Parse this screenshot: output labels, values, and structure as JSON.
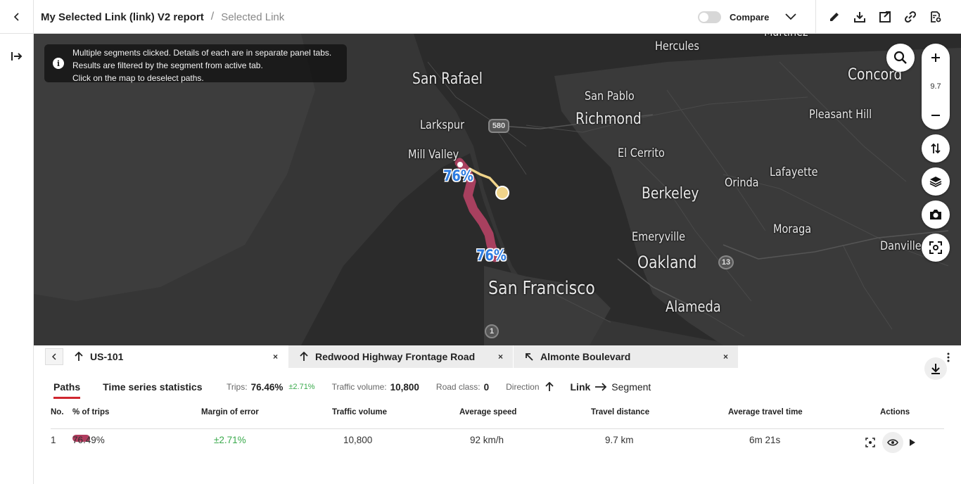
{
  "header": {
    "report_title": "My Selected Link (link) V2 report",
    "separator": "/",
    "subtitle": "Selected Link",
    "compare_label": "Compare"
  },
  "toolbar": {
    "icons": [
      "pencil-icon",
      "download-icon",
      "export-icon",
      "link-icon",
      "report-settings-icon"
    ]
  },
  "map": {
    "info_lines": [
      "Multiple segments clicked. Details of each are in separate panel tabs.",
      "Results are filtered by the segment from active tab.",
      "Click on the map to deselect paths."
    ],
    "zoom_level": "9.7",
    "cities": {
      "hercules": "Hercules",
      "martinez": "Martinez",
      "san_rafael": "San Rafael",
      "concord": "Concord",
      "san_pablo": "San Pablo",
      "richmond": "Richmond",
      "pleasant_hill": "Pleasant Hill",
      "larkspur": "Larkspur",
      "mill_valley": "Mill Valley",
      "el_cerrito": "El Cerrito",
      "lafayette": "Lafayette",
      "orinda": "Orinda",
      "berkeley": "Berkeley",
      "moraga": "Moraga",
      "emeryville": "Emeryville",
      "danville": "Danville",
      "oakland": "Oakland",
      "san_francisco": "San Francisco",
      "alameda": "Alameda"
    },
    "shields": {
      "i580": "580",
      "r13": "13",
      "r1": "1"
    },
    "path_pct_top": "76%",
    "path_pct_bottom": "76%",
    "path_color": "#a8405f",
    "secondary_path_color": "#f0d48a"
  },
  "panel": {
    "tabs": [
      {
        "label": "US-101",
        "direction": "up"
      },
      {
        "label": "Redwood Highway Frontage Road",
        "direction": "up"
      },
      {
        "label": "Almonte Boulevard",
        "direction": "up-left"
      }
    ],
    "close_symbol": "×",
    "subtabs": [
      "Paths",
      "Time series statistics"
    ],
    "stats": {
      "trips_label": "Trips:",
      "trips_value": "76.46%",
      "trips_moe": "±2.71%",
      "volume_label": "Traffic volume:",
      "volume_value": "10,800",
      "road_class_label": "Road class:",
      "road_class_value": "0",
      "direction_label": "Direction",
      "link_label": "Link",
      "segment_label": "Segment"
    },
    "columns": [
      "No.",
      "% of trips",
      "Margin of error",
      "Traffic volume",
      "Average speed",
      "Travel distance",
      "Average travel time",
      "Actions"
    ],
    "rows": [
      {
        "no": "1",
        "pct": "76.49%",
        "moe": "±2.71%",
        "volume": "10,800",
        "speed": "92 km/h",
        "distance": "9.7 km",
        "time": "6m 21s",
        "color": "#b03c5e"
      }
    ],
    "accent_color": "#d0262f",
    "moe_color": "#3aaa4c"
  }
}
